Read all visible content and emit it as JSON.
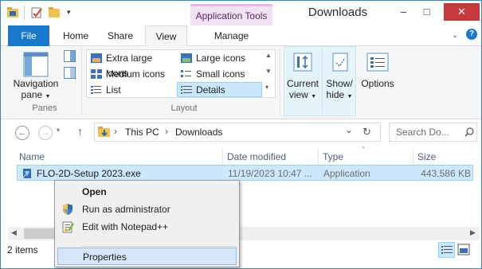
{
  "window": {
    "title": "Downloads",
    "contextual_tab_group": "Application Tools",
    "minimize": "–",
    "maximize": "□",
    "close": "✕"
  },
  "ribbon_tabs": [
    "File",
    "Home",
    "Share",
    "View",
    "Manage"
  ],
  "ribbon": {
    "panes": {
      "navigation_pane": "Navigation",
      "navigation_pane_2": "pane",
      "group_label": "Panes"
    },
    "layout": {
      "items": [
        "Extra large icons",
        "Large icons",
        "Medium icons",
        "Small icons",
        "List",
        "Details"
      ],
      "selected": "Details",
      "group_label": "Layout"
    },
    "current_view": {
      "line1": "Current",
      "line2": "view"
    },
    "show_hide": {
      "line1": "Show/",
      "line2": "hide"
    },
    "options": "Options"
  },
  "address": {
    "back_icon": "←",
    "forward_icon": "→",
    "up_icon": "↑",
    "crumbs": [
      "This PC",
      "Downloads"
    ],
    "sep": "›",
    "dropdown": "⌄",
    "refresh_icon": "↻",
    "search_placeholder": "Search Do..."
  },
  "columns": [
    "Name",
    "Date modified",
    "Type",
    "Size"
  ],
  "files": [
    {
      "name": "FLO-2D-Setup 2023.exe",
      "date": "11/19/2023 10:47 ...",
      "type": "Application",
      "size": "443,586 KB"
    }
  ],
  "status": {
    "count": "2 items"
  },
  "context_menu": {
    "items": [
      "Open",
      "Run as administrator",
      "Edit with Notepad++",
      "Properties"
    ],
    "highlighted": "Properties"
  },
  "colors": {
    "accent": "#1979ca",
    "selection": "#cce8ff",
    "contextual": "#f1e2f3",
    "close": "#c7383b"
  }
}
